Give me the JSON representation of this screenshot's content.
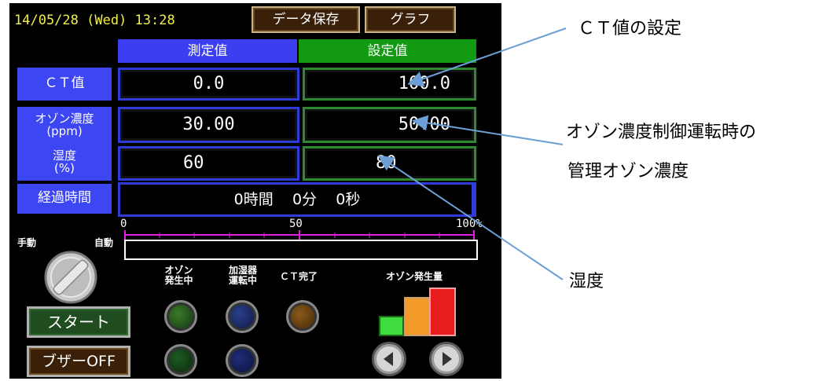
{
  "header": {
    "datetime": "14/05/28 (Wed) 13:28",
    "save_button": "データ保存",
    "graph_button": "グラフ"
  },
  "columns": {
    "measured": "測定值",
    "setpoint": "設定值"
  },
  "rows": [
    {
      "label": "ＣＴ值",
      "label_sub": "",
      "measured": "0.0",
      "setpoint": "100.0"
    },
    {
      "label": "オゾン濃度",
      "label_sub": "(ppm)",
      "measured": "30.00",
      "setpoint": "50.00"
    },
    {
      "label": "湿度",
      "label_sub": "(%)",
      "measured": "60",
      "setpoint": "80"
    }
  ],
  "elapsed": {
    "label": "経過時間",
    "hours": "0",
    "hours_unit": "時間",
    "minutes": "0",
    "minutes_unit": "分",
    "seconds": "0",
    "seconds_unit": "秒"
  },
  "progress": {
    "min_label": "0",
    "mid_label": "50",
    "max_label": "100%",
    "value_percent": 0
  },
  "mode": {
    "manual": "手動",
    "auto": "自動"
  },
  "lamps": {
    "ozone_generating": "オゾン\n発生中",
    "humidifier_running": "加湿器\n運転中",
    "ct_complete": "ＣＴ完了",
    "ozone_output": "オゾン発生量"
  },
  "buttons": {
    "start": "スタート",
    "buzzer_off": "ブザーOFF"
  },
  "annotations": {
    "ct_setting": "ＣＴ値の設定",
    "ozone_line1": "オゾン濃度制御運転時の",
    "ozone_line2": "管理オゾン濃度",
    "humidity": "湿度"
  },
  "colors": {
    "label_blue": "#3c46f2",
    "measured_header_blue": "#3b3ff0",
    "setpoint_header_green": "#139a13",
    "datetime_yellow": "#f2ef4a",
    "progress_magenta": "#e020e0",
    "annotation_line": "#6b9fd6"
  }
}
